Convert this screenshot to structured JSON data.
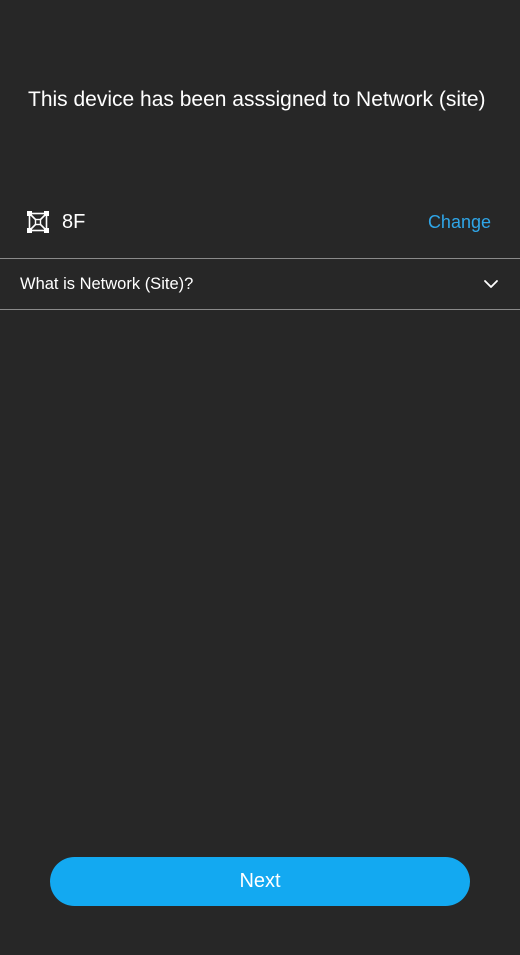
{
  "assignment": {
    "message": "This device has been asssigned to Network (site)"
  },
  "site": {
    "icon": "network-site-icon",
    "name": "8F",
    "change_label": "Change"
  },
  "faq": {
    "question": "What is Network (Site)?",
    "icon": "chevron-down-icon"
  },
  "footer": {
    "next_label": "Next"
  },
  "colors": {
    "background": "#272727",
    "accent": "#2fa6e8",
    "button": "#13a9f1",
    "divider": "#8a8a8a"
  }
}
